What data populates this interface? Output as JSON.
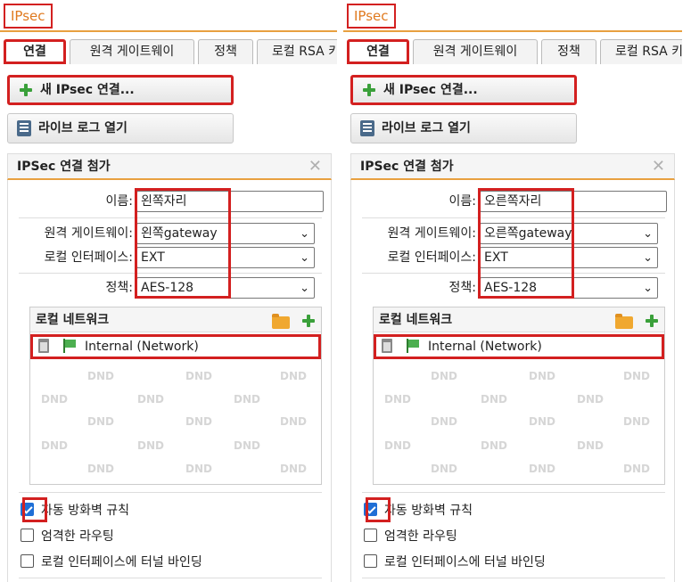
{
  "panels": [
    {
      "app_title": "IPsec",
      "tabs": [
        "연결",
        "원격 게이트웨이",
        "정책",
        "로컬 RSA 키"
      ],
      "new_button": "새 IPsec 연결...",
      "log_button": "라이브 로그 열기",
      "section_title": "IPSec 연결 첨가",
      "close_glyph": "✕",
      "fields": {
        "name": {
          "label": "이름:",
          "value": "왼쪽자리"
        },
        "remote_gateway": {
          "label": "원격 게이트웨이:",
          "value": "왼쪽gateway"
        },
        "local_interface": {
          "label": "로컬 인터페이스:",
          "value": "EXT"
        },
        "policy": {
          "label": "정책:",
          "value": "AES-128"
        }
      },
      "local_network": {
        "title": "로컬 네트워크",
        "item": "Internal (Network)",
        "placeholder": "DND"
      },
      "checkboxes": [
        {
          "label": "자동 방화벽 규칙",
          "checked": true
        },
        {
          "label": "엄격한 라우팅",
          "checked": false
        },
        {
          "label": "로컬 인터페이스에 터널 바인딩",
          "checked": false
        }
      ]
    },
    {
      "app_title": "IPsec",
      "tabs": [
        "연결",
        "원격 게이트웨이",
        "정책",
        "로컬 RSA 키"
      ],
      "new_button": "새 IPsec 연결...",
      "log_button": "라이브 로그 열기",
      "section_title": "IPSec 연결 첨가",
      "close_glyph": "✕",
      "fields": {
        "name": {
          "label": "이름:",
          "value": "오른쪽자리"
        },
        "remote_gateway": {
          "label": "원격 게이트웨이:",
          "value": "오른쪽gateway"
        },
        "local_interface": {
          "label": "로컬 인터페이스:",
          "value": "EXT"
        },
        "policy": {
          "label": "정책:",
          "value": "AES-128"
        }
      },
      "local_network": {
        "title": "로컬 네트워크",
        "item": "Internal (Network)",
        "placeholder": "DND"
      },
      "checkboxes": [
        {
          "label": "자동 방화벽 규칙",
          "checked": true
        },
        {
          "label": "엄격한 라우팅",
          "checked": false
        },
        {
          "label": "로컬 인터페이스에 터널 바인딩",
          "checked": false
        }
      ]
    }
  ],
  "colors": {
    "accent_orange": "#e8a040",
    "highlight_red": "#d32020",
    "checkbox_blue": "#1f6fd6",
    "add_green": "#3aa03a"
  },
  "icons": [
    "plus-icon",
    "log-icon",
    "close-icon",
    "chevron-down-icon",
    "folder-icon",
    "trash-icon",
    "flag-icon"
  ]
}
